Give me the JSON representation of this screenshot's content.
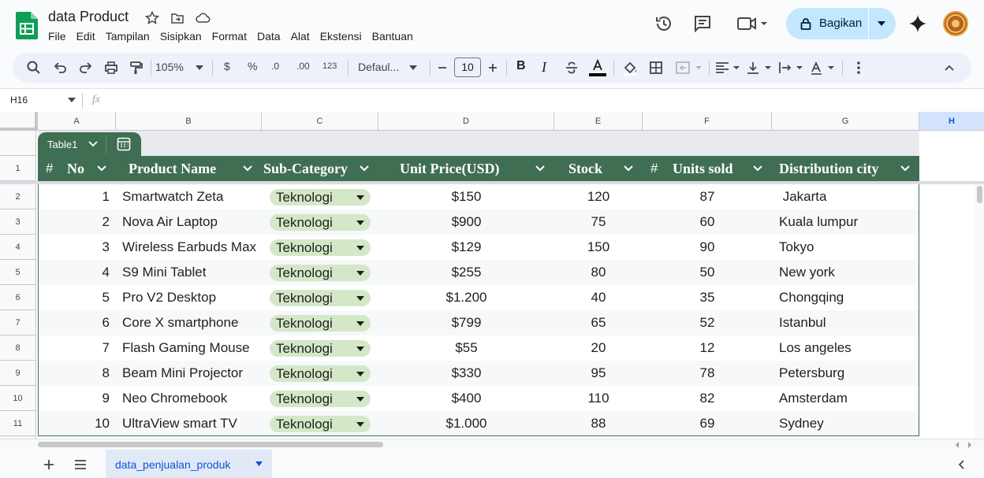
{
  "app": {
    "title": "data Product",
    "menu": [
      "File",
      "Edit",
      "Tampilan",
      "Sisipkan",
      "Format",
      "Data",
      "Alat",
      "Ekstensi",
      "Bantuan"
    ],
    "share_label": "Bagikan"
  },
  "toolbar": {
    "zoom": "105%",
    "currency": "$",
    "percent": "%",
    "dec_decrease": ".0",
    "dec_increase": ".00",
    "number_format": "123",
    "font": "Defaul...",
    "font_size": "10"
  },
  "formula_bar": {
    "cell_ref": "H16",
    "fx": "fx",
    "value": ""
  },
  "grid": {
    "columns": [
      "A",
      "B",
      "C",
      "D",
      "E",
      "F",
      "G",
      "H"
    ],
    "selected_column": "H",
    "row_numbers": [
      "1",
      "2",
      "3",
      "4",
      "5",
      "6",
      "7",
      "8",
      "9",
      "10",
      "11"
    ]
  },
  "table": {
    "name": "Table1",
    "headers": {
      "no": "No",
      "product": "Product Name",
      "subcategory": "Sub-Category",
      "price": "Unit Price(USD)",
      "stock": "Stock",
      "units": "Units sold",
      "city": "Distribution city"
    },
    "number_glyph": "#",
    "rows": [
      {
        "no": "1",
        "product": "Smartwatch Zeta",
        "subcategory": "Teknologi",
        "price": "$150",
        "stock": "120",
        "units": "87",
        "city": " Jakarta"
      },
      {
        "no": "2",
        "product": "Nova Air Laptop",
        "subcategory": "Teknologi",
        "price": "$900",
        "stock": "75",
        "units": "60",
        "city": "Kuala lumpur"
      },
      {
        "no": "3",
        "product": "Wireless Earbuds Max",
        "subcategory": "Teknologi",
        "price": "$129",
        "stock": "150",
        "units": "90",
        "city": "Tokyo"
      },
      {
        "no": "4",
        "product": "S9 Mini Tablet",
        "subcategory": "Teknologi",
        "price": "$255",
        "stock": "80",
        "units": "50",
        "city": "New york"
      },
      {
        "no": "5",
        "product": "Pro V2 Desktop",
        "subcategory": "Teknologi",
        "price": "$1.200",
        "stock": "40",
        "units": "35",
        "city": "Chongqing"
      },
      {
        "no": "6",
        "product": "Core X smartphone",
        "subcategory": "Teknologi",
        "price": "$799",
        "stock": "65",
        "units": "52",
        "city": "Istanbul"
      },
      {
        "no": "7",
        "product": "Flash Gaming Mouse",
        "subcategory": "Teknologi",
        "price": "$55",
        "stock": "20",
        "units": "12",
        "city": "Los angeles"
      },
      {
        "no": "8",
        "product": "Beam Mini Projector",
        "subcategory": "Teknologi",
        "price": "$330",
        "stock": "95",
        "units": "78",
        "city": "Petersburg"
      },
      {
        "no": "9",
        "product": "Neo Chromebook",
        "subcategory": "Teknologi",
        "price": "$400",
        "stock": "110",
        "units": "82",
        "city": "Amsterdam"
      },
      {
        "no": "10",
        "product": "UltraView smart TV",
        "subcategory": "Teknologi",
        "price": "$1.000",
        "stock": "88",
        "units": "69",
        "city": "Sydney"
      }
    ]
  },
  "sheet_tabs": [
    {
      "label": "data_penjualan_produk",
      "active": true
    }
  ],
  "colors": {
    "header_green": "#3f6e53",
    "chip_green": "#d4e8c8",
    "share_blue": "#c2e7ff",
    "active_tab": "#0b57d0"
  }
}
